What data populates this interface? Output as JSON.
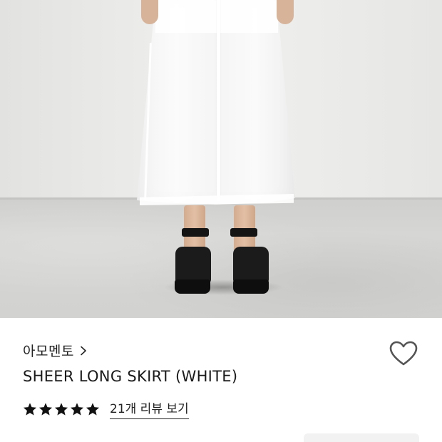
{
  "product": {
    "brand": "아모멘토",
    "brand_icon": "chevron-right-icon",
    "title": "SHEER LONG SKIRT (WHITE)",
    "wishlist_icon": "heart-outline-icon",
    "rating": {
      "stars": 5,
      "max": 5,
      "review_link": "21개 리뷰 보기"
    }
  },
  "colors": {
    "text": "#1a1a1a",
    "star": "#111111",
    "chip": "#f2f2f2"
  }
}
